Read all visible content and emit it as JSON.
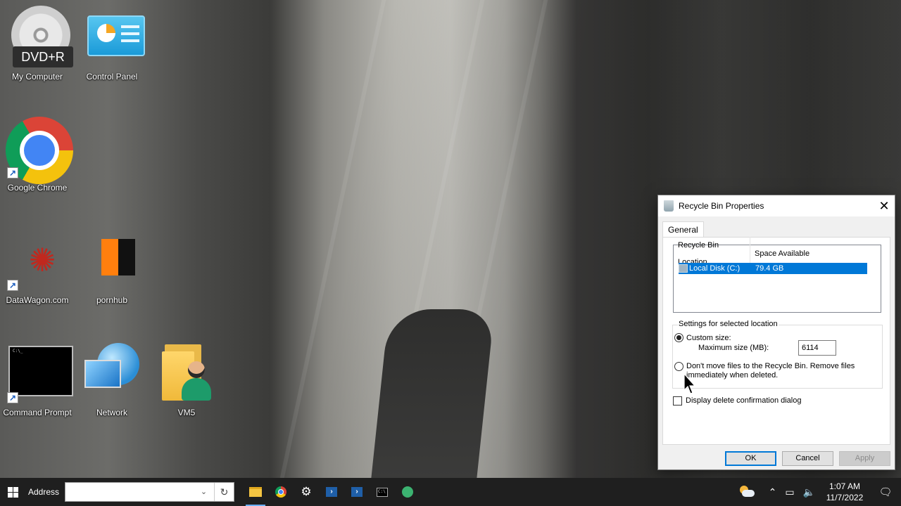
{
  "desktop": {
    "icons": [
      {
        "label": "My Computer",
        "overlay": "DVD+R",
        "icon": "dvd-drive-icon"
      },
      {
        "label": "Control Panel",
        "icon": "control-panel-icon"
      },
      {
        "label": "Google Chrome",
        "icon": "chrome-icon"
      },
      {
        "label": "DataWagon.com",
        "icon": "datawagon-icon"
      },
      {
        "label": "pornhub",
        "icon": "pornhub-icon"
      },
      {
        "label": "Command Prompt",
        "icon": "command-prompt-icon"
      },
      {
        "label": "Network",
        "icon": "network-icon"
      },
      {
        "label": "VM5",
        "icon": "user-folder-icon"
      }
    ]
  },
  "dialog": {
    "title": "Recycle Bin Properties",
    "tabs": [
      {
        "label": "General"
      }
    ],
    "list": {
      "columns": [
        "Recycle Bin Location",
        "Space Available"
      ],
      "rows": [
        {
          "location": "Local Disk (C:)",
          "space": "79.4 GB",
          "selected": true
        }
      ]
    },
    "group_label": "Settings for selected location",
    "custom_size_label": "Custom size:",
    "max_size_label": "Maximum size (MB):",
    "max_size_value": "6114",
    "dont_move_label_line1": "Don't move files to the Recycle Bin. Remove files",
    "dont_move_label_line2": "immediately when deleted.",
    "confirm_label": "Display delete confirmation dialog",
    "custom_size_selected": true,
    "confirm_checked": false,
    "buttons": {
      "ok": "OK",
      "cancel": "Cancel",
      "apply": "Apply"
    }
  },
  "taskbar": {
    "address_label": "Address",
    "address_value": "",
    "apps": [
      "file-explorer-icon",
      "chrome-icon",
      "settings-gear-icon",
      "powershell-icon",
      "powershell-icon",
      "command-prompt-icon",
      "app-icon"
    ],
    "clock_time": "1:07 AM",
    "clock_date": "11/7/2022"
  },
  "colors": {
    "selection": "#0078d7",
    "taskbar": "#1f1f1f",
    "dialog_bg": "#f0f0f0"
  }
}
